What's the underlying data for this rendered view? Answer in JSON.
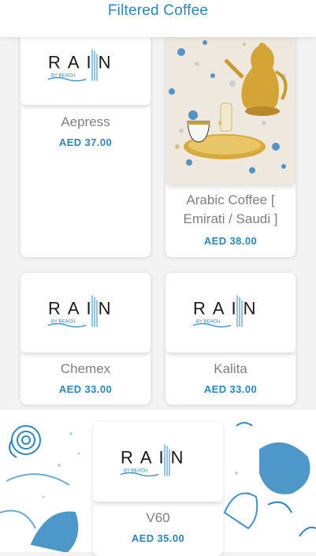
{
  "header": {
    "title": "Filtered Coffee"
  },
  "logo": {
    "brand": "RAIN",
    "sub": "BY BEACH"
  },
  "products": [
    {
      "name": "Aepress",
      "price": "AED 37.00",
      "image": "logo"
    },
    {
      "name": "Arabic Coffee [ Emirati / Saudi ]",
      "price": "AED 38.00",
      "image": "photo"
    },
    {
      "name": "Chemex",
      "price": "AED 33.00",
      "image": "logo"
    },
    {
      "name": "Kalita",
      "price": "AED 33.00",
      "image": "logo"
    },
    {
      "name": "V60",
      "price": "AED 35.00",
      "image": "logo"
    }
  ],
  "colors": {
    "accent": "#2c86b8",
    "muted_text": "#7f7f7f",
    "background": "#f3f3f3"
  }
}
